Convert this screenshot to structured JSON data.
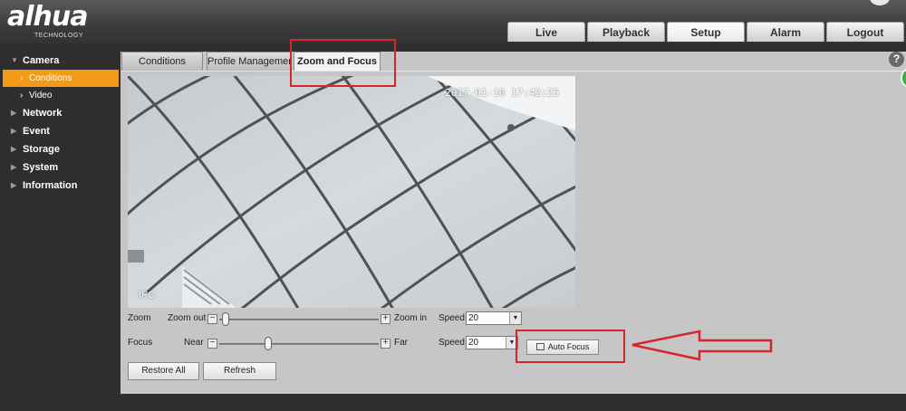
{
  "header": {
    "logo_text": "alhua",
    "logo_sub": "TECHNOLOGY",
    "nav": [
      "Live",
      "Playback",
      "Setup",
      "Alarm",
      "Logout"
    ],
    "active_nav": "Setup"
  },
  "sidebar": {
    "groups": [
      {
        "label": "Camera",
        "expanded": true
      },
      {
        "label": "Network"
      },
      {
        "label": "Event"
      },
      {
        "label": "Storage"
      },
      {
        "label": "System"
      },
      {
        "label": "Information"
      }
    ],
    "camera_items": [
      {
        "label": "Conditions",
        "active": true
      },
      {
        "label": "Video"
      }
    ]
  },
  "tabs": [
    "Conditions",
    "Profile Management",
    "Zoom and Focus"
  ],
  "active_tab": "Zoom and Focus",
  "video": {
    "timestamp": "2017-01-10 17:42:25",
    "channel_label": "IPC"
  },
  "zoom": {
    "label": "Zoom",
    "min_label": "Zoom out",
    "max_label": "Zoom in",
    "level": 0.02,
    "speed_label": "Speed",
    "speed_value": "20"
  },
  "focus": {
    "label": "Focus",
    "min_label": "Near",
    "max_label": "Far",
    "level": 0.3,
    "speed_label": "Speed",
    "speed_value": "20"
  },
  "auto_focus_label": "Auto Focus",
  "buttons": {
    "restore": "Restore All",
    "refresh": "Refresh"
  },
  "help_icon": "?",
  "colors": {
    "accent": "#f39a1a",
    "annotation": "#d6262c",
    "panel": "#c6c6c6",
    "dark": "#2e2e2e"
  },
  "icons": [
    "help-icon",
    "auto-focus-icon",
    "minus-icon",
    "plus-icon",
    "dropdown-arrow-icon",
    "chevron-right-icon",
    "triangle-icon"
  ]
}
